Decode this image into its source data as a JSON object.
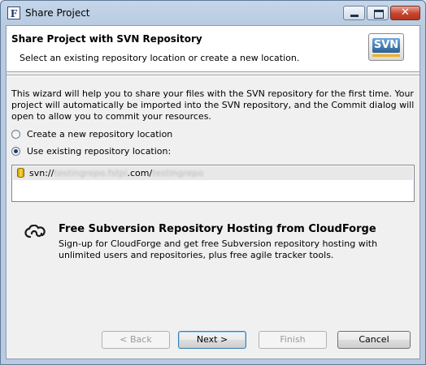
{
  "window": {
    "title": "Share Project",
    "app_icon_letter": "F"
  },
  "titlebar_buttons": {
    "minimize": "minimize",
    "maximize": "maximize",
    "close": "✕"
  },
  "banner": {
    "title": "Share Project with SVN Repository",
    "description": "Select an existing repository location or create a new location.",
    "logo_text": "SVN"
  },
  "intro_text": "This wizard will help you to share your files with the SVN repository for the first time. Your project will automatically be imported into the SVN repository, and the Commit dialog will open to allow you to commit your resources.",
  "options": {
    "create_new": {
      "label": "Create a new repository location",
      "selected": false
    },
    "use_existing": {
      "label": "Use existing repository location:",
      "selected": true
    }
  },
  "repositories": [
    {
      "prefix": "svn://",
      "host_blurred": "testingrepo.fstpl",
      "mid": ".com/",
      "path_blurred": "testingrepo"
    }
  ],
  "promo": {
    "title": "Free Subversion Repository Hosting from CloudForge",
    "text": "Sign-up for CloudForge and get free Subversion repository hosting with unlimited users and repositories, plus free agile tracker tools."
  },
  "buttons": {
    "back": "< Back",
    "next": "Next >",
    "finish": "Finish",
    "cancel": "Cancel"
  }
}
